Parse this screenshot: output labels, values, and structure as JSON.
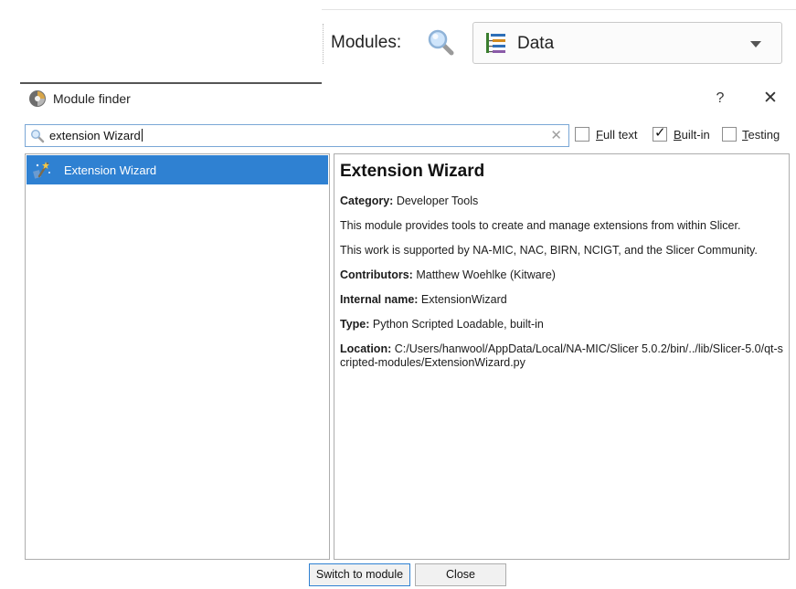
{
  "toolbar": {
    "modules_label": "Modules:",
    "module_selector": {
      "selected": "Data"
    }
  },
  "dialog": {
    "title": "Module finder",
    "help": "?",
    "close": "✕",
    "search": {
      "value": "extension Wizard",
      "clear": "✕"
    },
    "filters": [
      {
        "label_pre": "",
        "mnemonic": "F",
        "label_post": "ull text",
        "checked": false
      },
      {
        "label_pre": "",
        "mnemonic": "B",
        "label_post": "uilt-in",
        "checked": true
      },
      {
        "label_pre": "",
        "mnemonic": "T",
        "label_post": "esting",
        "checked": false
      }
    ],
    "results": [
      {
        "label": "Extension Wizard",
        "selected": true
      }
    ],
    "details": {
      "title": "Extension Wizard",
      "category_label": "Category:",
      "category": "Developer Tools",
      "description": "This module provides tools to create and manage extensions from within Slicer.",
      "acknowledgement": "This work is supported by NA-MIC, NAC, BIRN, NCIGT, and the Slicer Community.",
      "contributors_label": "Contributors:",
      "contributors": "Matthew Woehlke (Kitware)",
      "internal_name_label": "Internal name:",
      "internal_name": "ExtensionWizard",
      "type_label": "Type:",
      "type": "Python Scripted Loadable, built-in",
      "location_label": "Location:",
      "location": "C:/Users/hanwool/AppData/Local/NA-MIC/Slicer 5.0.2/bin/../lib/Slicer-5.0/qt-scripted-modules/ExtensionWizard.py"
    },
    "buttons": {
      "switch": "Switch to module",
      "close": "Close"
    }
  },
  "colors": {
    "selection": "#2f81d2",
    "focus_border": "#7aa7d6"
  }
}
